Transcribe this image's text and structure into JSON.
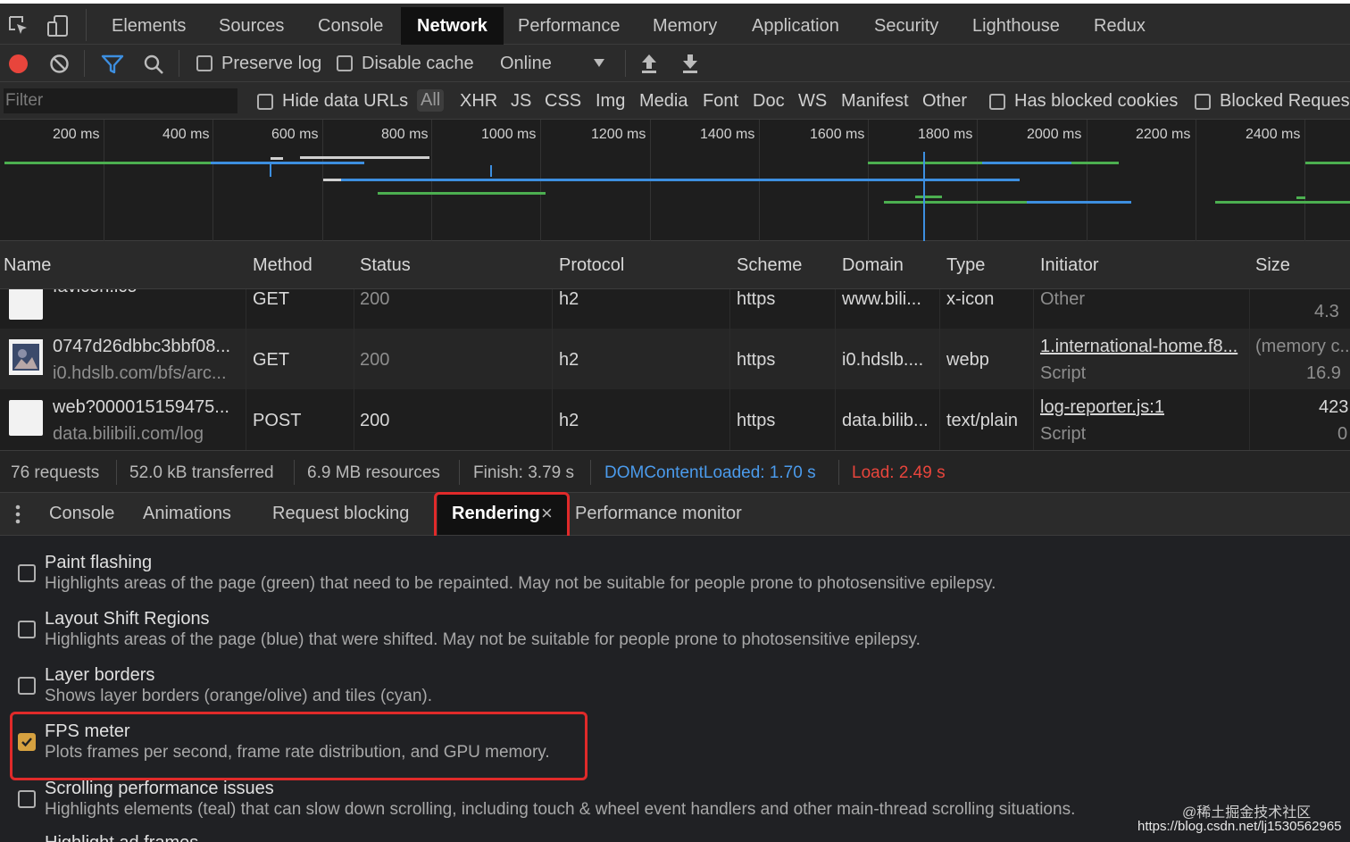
{
  "main_tabs": [
    "Elements",
    "Sources",
    "Console",
    "Network",
    "Performance",
    "Memory",
    "Application",
    "Security",
    "Lighthouse",
    "Redux"
  ],
  "active_tab": "Network",
  "toolbar": {
    "preserve_log": "Preserve log",
    "disable_cache": "Disable cache",
    "throttling": "Online"
  },
  "filter": {
    "placeholder": "Filter",
    "hide_data_urls": "Hide data URLs",
    "types": [
      "All",
      "XHR",
      "JS",
      "CSS",
      "Img",
      "Media",
      "Font",
      "Doc",
      "WS",
      "Manifest",
      "Other"
    ],
    "has_blocked_cookies": "Has blocked cookies",
    "blocked_requests": "Blocked Reques"
  },
  "timeline": {
    "ticks": [
      "200 ms",
      "400 ms",
      "600 ms",
      "800 ms",
      "1000 ms",
      "1200 ms",
      "1400 ms",
      "1600 ms",
      "1800 ms",
      "2000 ms",
      "2200 ms",
      "2400 ms"
    ],
    "colors": {
      "green": "#4caf50",
      "blue": "#3d8fe0",
      "white": "#d0d0d0"
    }
  },
  "table": {
    "columns": [
      "Name",
      "Method",
      "Status",
      "Protocol",
      "Scheme",
      "Domain",
      "Type",
      "Initiator",
      "Size"
    ],
    "rows": [
      {
        "name": "favicon.ico",
        "path": "",
        "method": "GET",
        "status": "200",
        "protocol": "h2",
        "scheme": "https",
        "domain": "www.bili...",
        "type": "x-icon",
        "initiator": "Other",
        "initiator_sub": "",
        "size1": "",
        "size2": "4.3"
      },
      {
        "name": "0747d26dbbc3bbf08...",
        "path": "i0.hdslb.com/bfs/arc...",
        "method": "GET",
        "status": "200",
        "protocol": "h2",
        "scheme": "https",
        "domain": "i0.hdslb....",
        "type": "webp",
        "initiator": "1.international-home.f8...",
        "initiator_sub": "Script",
        "size1": "(memory c...",
        "size2": "16.9"
      },
      {
        "name": "web?000015159475...",
        "path": "data.bilibili.com/log",
        "method": "POST",
        "status": "200",
        "protocol": "h2",
        "scheme": "https",
        "domain": "data.bilib...",
        "type": "text/plain",
        "initiator": "log-reporter.js:1",
        "initiator_sub": "Script",
        "size1": "423",
        "size2": "0"
      }
    ]
  },
  "summary": {
    "requests": "76 requests",
    "transferred": "52.0 kB transferred",
    "resources": "6.9 MB resources",
    "finish": "Finish: 3.79 s",
    "dom_content_loaded": "DOMContentLoaded: 1.70 s",
    "load": "Load: 2.49 s",
    "dcl_color": "#4b9bec",
    "load_color": "#e8453c"
  },
  "drawer": {
    "tabs": [
      "Console",
      "Animations",
      "Request blocking",
      "Rendering",
      "Performance monitor"
    ],
    "active": "Rendering"
  },
  "rendering_options": [
    {
      "title": "Paint flashing",
      "desc": "Highlights areas of the page (green) that need to be repainted. May not be suitable for people prone to photosensitive epilepsy.",
      "checked": false
    },
    {
      "title": "Layout Shift Regions",
      "desc": "Highlights areas of the page (blue) that were shifted. May not be suitable for people prone to photosensitive epilepsy.",
      "checked": false
    },
    {
      "title": "Layer borders",
      "desc": "Shows layer borders (orange/olive) and tiles (cyan).",
      "checked": false
    },
    {
      "title": "FPS meter",
      "desc": "Plots frames per second, frame rate distribution, and GPU memory.",
      "checked": true
    },
    {
      "title": "Scrolling performance issues",
      "desc": "Highlights elements (teal) that can slow down scrolling, including touch & wheel event handlers and other main-thread scrolling situations.",
      "checked": false
    },
    {
      "title": "Highlight ad frames",
      "desc": "",
      "checked": false
    }
  ],
  "watermark": {
    "line1": "@稀土掘金技术社区",
    "line2": "https://blog.csdn.net/lj1530562965"
  }
}
